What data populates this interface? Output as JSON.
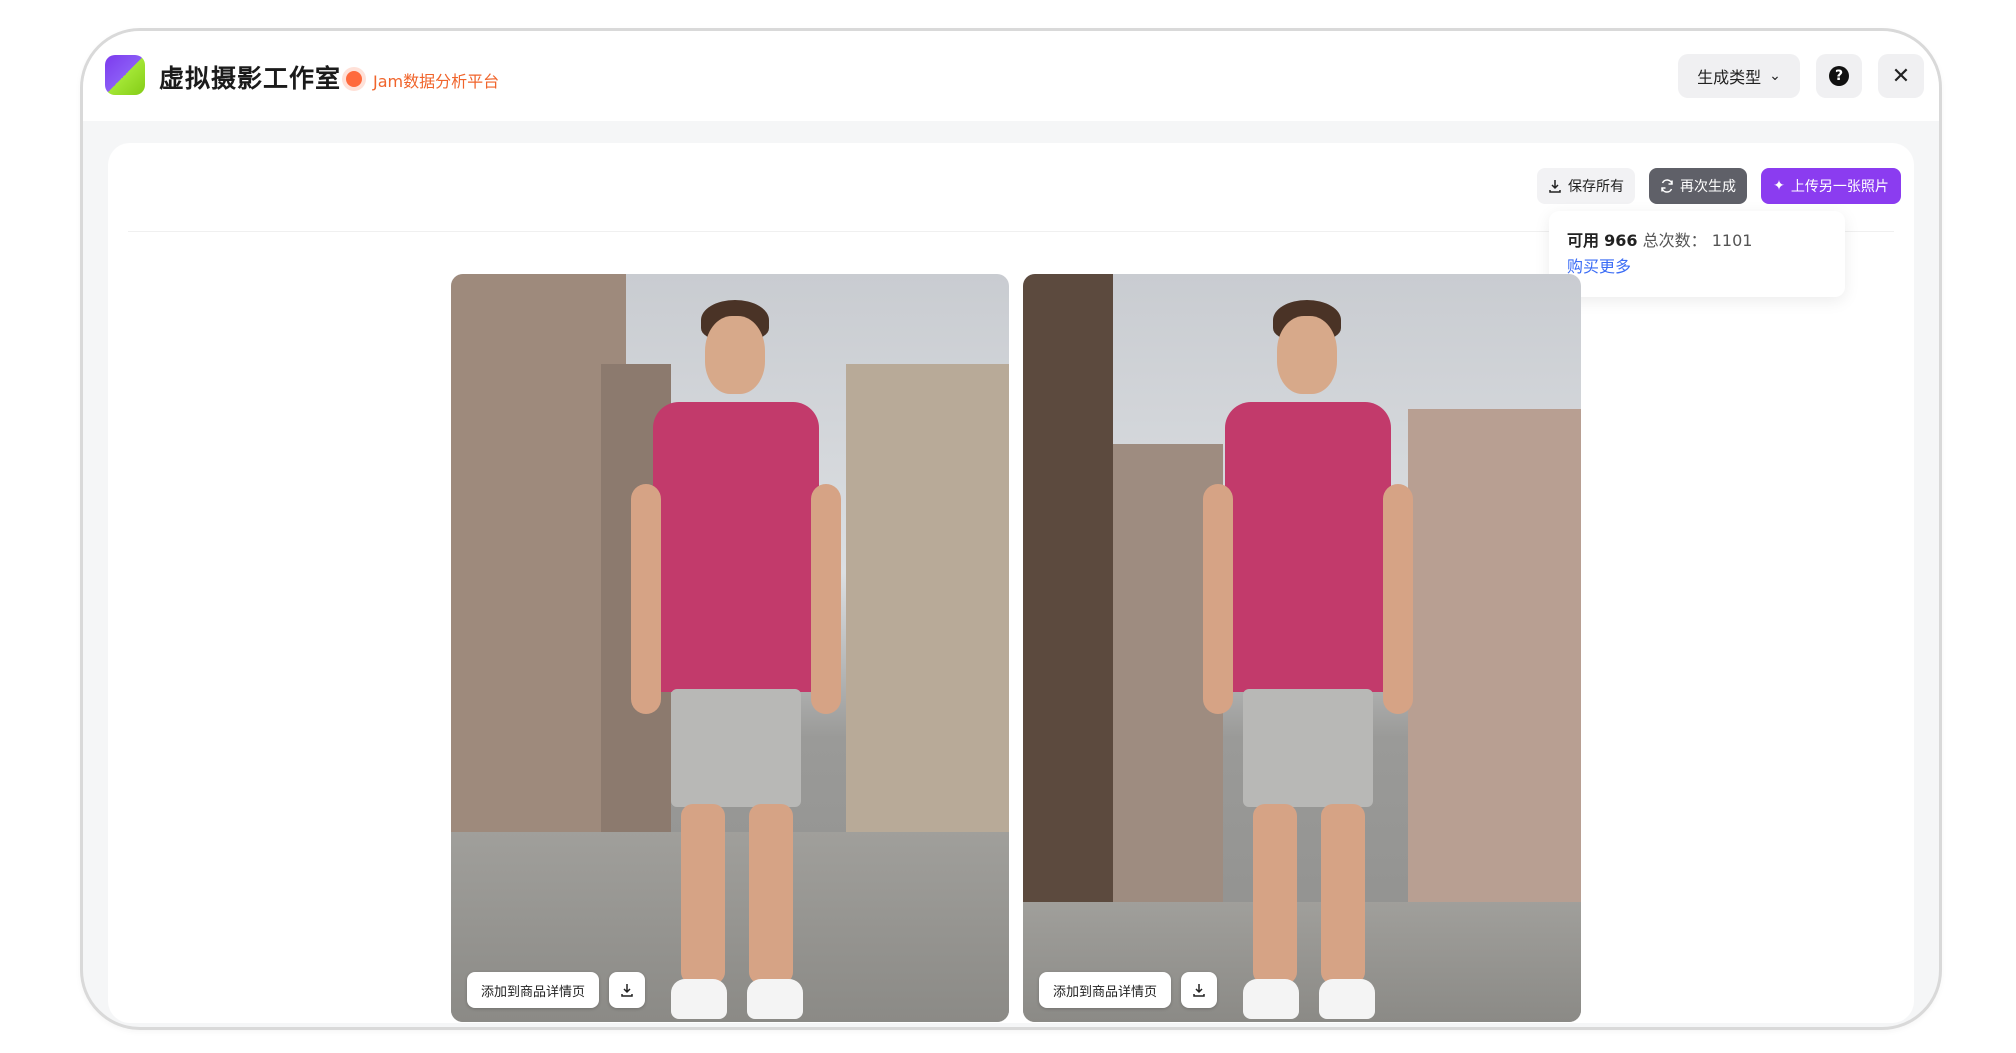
{
  "header": {
    "app_title": "虚拟摄影工作室",
    "brand_label": "Jam数据分析平台",
    "type_dropdown_label": "生成类型",
    "help_icon": "question-circle-icon",
    "close_icon": "close-icon",
    "logo_icon": "app-logo-icon"
  },
  "actions": {
    "save_all": "保存所有",
    "regenerate": "再次生成",
    "upload_another": "上传另一张照片"
  },
  "credits": {
    "available_label": "可用",
    "available_count": "966",
    "total_label": "总次数：",
    "total_count": "1101",
    "buy_more": "购买更多"
  },
  "results": [
    {
      "add_to_detail": "添加到商品详情页",
      "download_icon": "download-icon"
    },
    {
      "add_to_detail": "添加到商品详情页",
      "download_icon": "download-icon"
    }
  ],
  "colors": {
    "accent_purple": "#8b3cf0",
    "brand_orange": "#f0642b",
    "link_blue": "#3b6cf5",
    "shirt_color": "#c23a6b"
  }
}
